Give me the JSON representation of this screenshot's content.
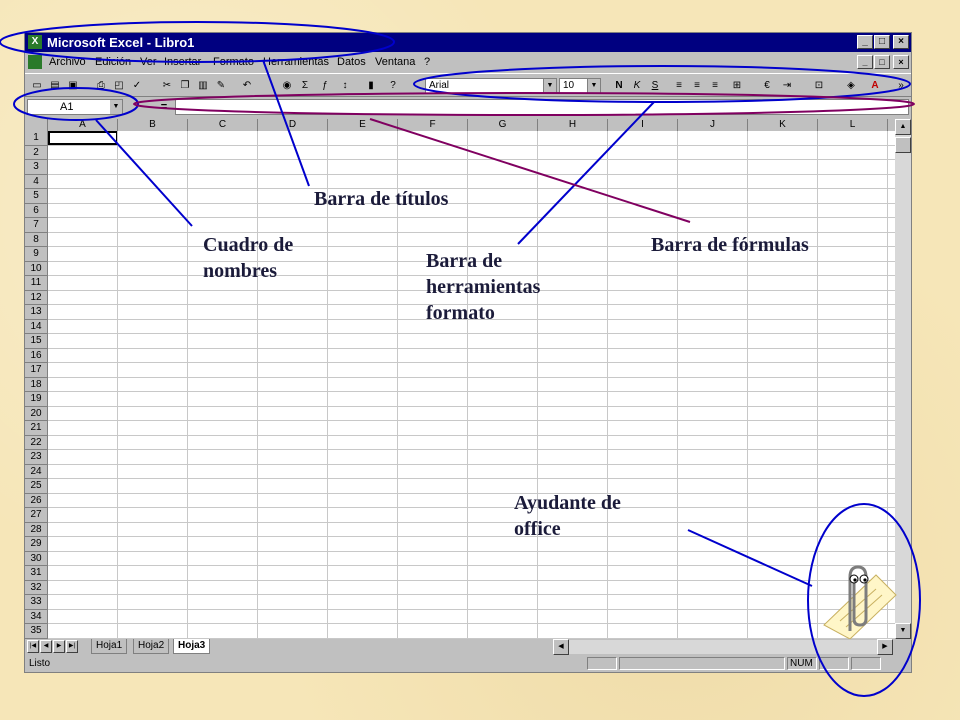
{
  "window": {
    "title": "Microsoft Excel - Libro1",
    "icon": "excel-icon"
  },
  "menu": [
    "Archivo",
    "Edición",
    "Ver",
    "Insertar",
    "Formato",
    "Herramientas",
    "Datos",
    "Ventana",
    "?"
  ],
  "toolbar": {
    "font": "Arial",
    "size": "10",
    "buttons": [
      "new-icon",
      "open-icon",
      "save-icon",
      "print-icon",
      "preview-icon",
      "spelling-icon",
      "cut-icon",
      "copy-icon",
      "paste-icon",
      "format-painter-icon",
      "undo-icon",
      "hyperlink-icon",
      "autosum-icon",
      "function-icon",
      "sort-icon",
      "chart-icon",
      "help-icon"
    ],
    "bold": "N",
    "italic": "K",
    "underline": "S",
    "euro": "€"
  },
  "formula_bar": {
    "name_box": "A1",
    "equals": "="
  },
  "columns": [
    "A",
    "B",
    "C",
    "D",
    "E",
    "F",
    "G",
    "H",
    "I",
    "J",
    "K",
    "L"
  ],
  "rows": [
    "1",
    "2",
    "3",
    "4",
    "5",
    "6",
    "7",
    "8",
    "9",
    "10",
    "11",
    "12",
    "13",
    "14",
    "15",
    "16",
    "17",
    "18",
    "19",
    "20",
    "21",
    "22",
    "23",
    "24",
    "25",
    "26",
    "27",
    "28",
    "29",
    "30",
    "31",
    "32",
    "33",
    "34",
    "35"
  ],
  "sheets": [
    "Hoja1",
    "Hoja2",
    "Hoja3"
  ],
  "active_sheet": "Hoja3",
  "status": {
    "left": "Listo",
    "num": "NUM"
  },
  "callouts": {
    "titulos": "Barra de títulos",
    "nombres_1": "Cuadro de",
    "nombres_2": "nombres",
    "herramientas_1": "Barra de",
    "herramientas_2": "herramientas",
    "herramientas_3": "formato",
    "formulas": "Barra de fórmulas",
    "ayudante_1": "Ayudante de",
    "ayudante_2": "office"
  },
  "colors": {
    "title_bar": "#000080",
    "callout_blue": "#0000cc",
    "callout_purple": "#800060"
  }
}
